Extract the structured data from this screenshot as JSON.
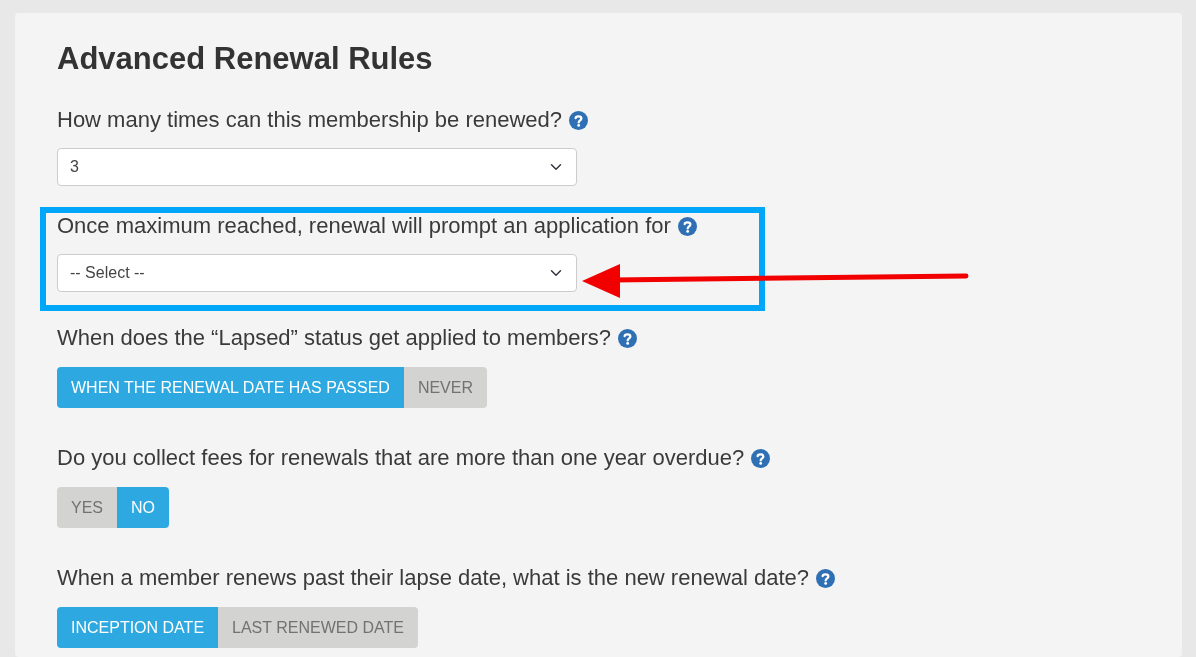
{
  "title": "Advanced Renewal Rules",
  "sections": [
    {
      "kind": "select",
      "question": "How many times can this membership be renewed?",
      "value": "3",
      "highlighted": false
    },
    {
      "kind": "select",
      "question": "Once maximum reached, renewal will prompt an application for",
      "value": "-- Select --",
      "highlighted": true,
      "arrow": true
    },
    {
      "kind": "toggle",
      "question": "When does the “Lapsed” status get applied to members?",
      "options": [
        {
          "label": "WHEN THE RENEWAL DATE HAS PASSED",
          "selected": true
        },
        {
          "label": "NEVER",
          "selected": false
        }
      ],
      "highlighted": false
    },
    {
      "kind": "toggle",
      "question": "Do you collect fees for renewals that are more than one year overdue?",
      "options": [
        {
          "label": "YES",
          "selected": false
        },
        {
          "label": "NO",
          "selected": true
        }
      ],
      "highlighted": false
    },
    {
      "kind": "toggle",
      "question": "When a member renews past their lapse date, what is the new renewal date?",
      "options": [
        {
          "label": "INCEPTION DATE",
          "selected": true
        },
        {
          "label": "LAST RENEWED DATE",
          "selected": false
        }
      ],
      "highlighted": false
    }
  ]
}
